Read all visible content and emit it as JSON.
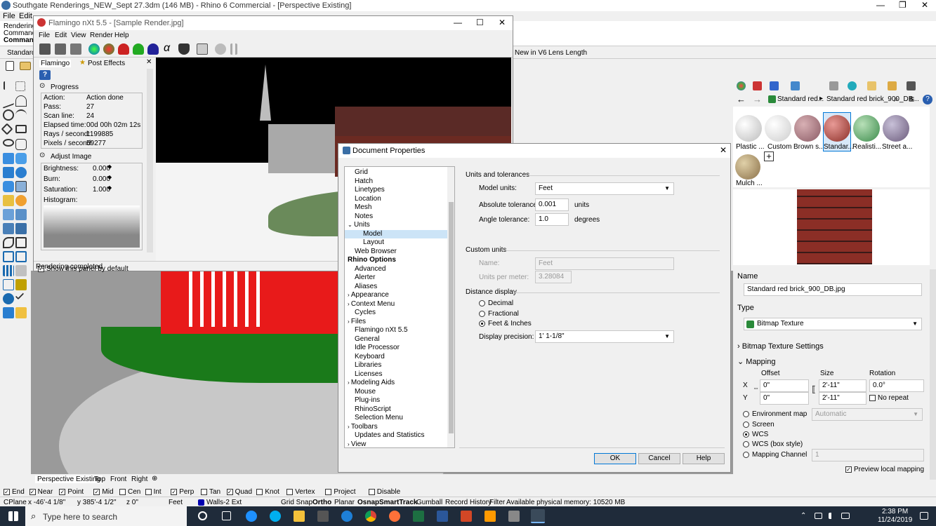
{
  "rhino": {
    "title": "Southgate Renderings_NEW_Sept 27.3dm (146 MB) - Rhino 6 Commercial - [Perspective Existing]",
    "menu": [
      "File",
      "Edit"
    ],
    "cmd_history": "Rendering t",
    "command_label": "Command:",
    "command_label2": "Command:",
    "tab_standard": "Standard",
    "tab_new_v6": "New in V6",
    "tab_lens": "Lens Length"
  },
  "flamingo": {
    "title": "Flamingo nXt 5.5 - [Sample Render.jpg]",
    "menu": [
      "File",
      "Edit",
      "View",
      "Render",
      "Help"
    ],
    "tabs": [
      "Flamingo",
      "Post Effects"
    ],
    "progress_header": "Progress",
    "progress": [
      [
        "Action:",
        "Action done"
      ],
      [
        "Pass:",
        "27"
      ],
      [
        "Scan line:",
        "24"
      ],
      [
        "Elapsed time:",
        "00d 00h 02m 12s"
      ],
      [
        "Rays / second:",
        "1199885"
      ],
      [
        "Pixels / second:",
        "59277"
      ]
    ],
    "adjust_header": "Adjust Image",
    "adjust": [
      [
        "Brightness:",
        "0.000"
      ],
      [
        "Burn:",
        "0.000"
      ],
      [
        "Saturation:",
        "1.000"
      ]
    ],
    "histogram_label": "Histogram:",
    "show_panel": "Show this panel by default",
    "status": "Rendering completed"
  },
  "doc": {
    "title": "Document Properties",
    "tree": [
      "Grid",
      "Hatch",
      "Linetypes",
      "Location",
      "Mesh",
      "Notes",
      "Units",
      "Model",
      "Layout",
      "Web Browser",
      "Rhino Options",
      "Advanced",
      "Alerter",
      "Aliases",
      "Appearance",
      "Context Menu",
      "Cycles",
      "Files",
      "Flamingo nXt 5.5",
      "General",
      "Idle Processor",
      "Keyboard",
      "Libraries",
      "Licenses",
      "Modeling Aids",
      "Mouse",
      "Plug-ins",
      "RhinoScript",
      "Selection Menu",
      "Toolbars",
      "Updates and Statistics",
      "View"
    ],
    "units_header": "Units and tolerances",
    "model_units_label": "Model units:",
    "model_units": "Feet",
    "abs_tol_label": "Absolute tolerance:",
    "abs_tol": "0.001",
    "abs_tol_unit": "units",
    "angle_tol_label": "Angle tolerance:",
    "angle_tol": "1.0",
    "angle_tol_unit": "degrees",
    "custom_header": "Custom units",
    "name_label": "Name:",
    "name_value": "Feet",
    "upm_label": "Units per meter:",
    "upm_value": "3.28084",
    "distance_header": "Distance display",
    "opt_decimal": "Decimal",
    "opt_fractional": "Fractional",
    "opt_feet": "Feet & Inches",
    "precision_label": "Display precision:",
    "precision": "1' 1-1/8\"",
    "ok": "OK",
    "cancel": "Cancel",
    "help": "Help"
  },
  "materials": {
    "thumbs": [
      "Plastic ...",
      "Custom",
      "Brown s...",
      "Standar...",
      "Realisti...",
      "Street a...",
      "Mulch ..."
    ],
    "path1": "Standard red...",
    "path2": "Standard red brick_900_DB...",
    "name_label": "Name",
    "name_value": "Standard red brick_900_DB.jpg",
    "type_label": "Type",
    "type_value": "Bitmap Texture",
    "bitmap_settings": "Bitmap Texture Settings",
    "mapping": "Mapping",
    "offset": "Offset",
    "size": "Size",
    "rotation": "Rotation",
    "x": "X",
    "y": "Y",
    "off_x": "0\"",
    "off_y": "0\"",
    "size_x": "2'-11\"",
    "size_y": "2'-11\"",
    "rot": "0.0°",
    "no_repeat": "No repeat",
    "env_map": "Environment map",
    "env_value": "Automatic",
    "screen": "Screen",
    "wcs": "WCS",
    "wcs_box": "WCS (box style)",
    "mapping_channel": "Mapping Channel",
    "channel_value": "1",
    "preview_local": "Preview local mapping"
  },
  "viewport_tabs": [
    "Perspective Existing",
    "Top",
    "Front",
    "Right"
  ],
  "osnap": [
    "End",
    "Near",
    "Point",
    "Mid",
    "Cen",
    "Int",
    "Perp",
    "Tan",
    "Quad",
    "Knot",
    "Vertex",
    "Project",
    "Disable"
  ],
  "osnap_checked": [
    true,
    true,
    true,
    true,
    false,
    false,
    true,
    false,
    true,
    false,
    false,
    false,
    false
  ],
  "status": {
    "cplane": "CPlane",
    "x": "x -46'-4 1/8\"",
    "y": "y 385'-4 1/2\"",
    "z": "z 0\"",
    "units": "Feet",
    "layer": "Walls-2 Ext",
    "toggles": [
      "Grid Snap",
      "Ortho",
      "Planar",
      "Osnap",
      "SmartTrack",
      "Gumball",
      "Record History",
      "Filter"
    ],
    "memory": "Available physical memory: 10520 MB"
  },
  "taskbar": {
    "search": "Type here to search",
    "time": "2:38 PM",
    "date": "11/24/2019"
  },
  "colors": {
    "brick": "#8b2e26",
    "grass": "#1a7a1a",
    "red_building": "#e81a1a",
    "accent": "#0078d7"
  }
}
